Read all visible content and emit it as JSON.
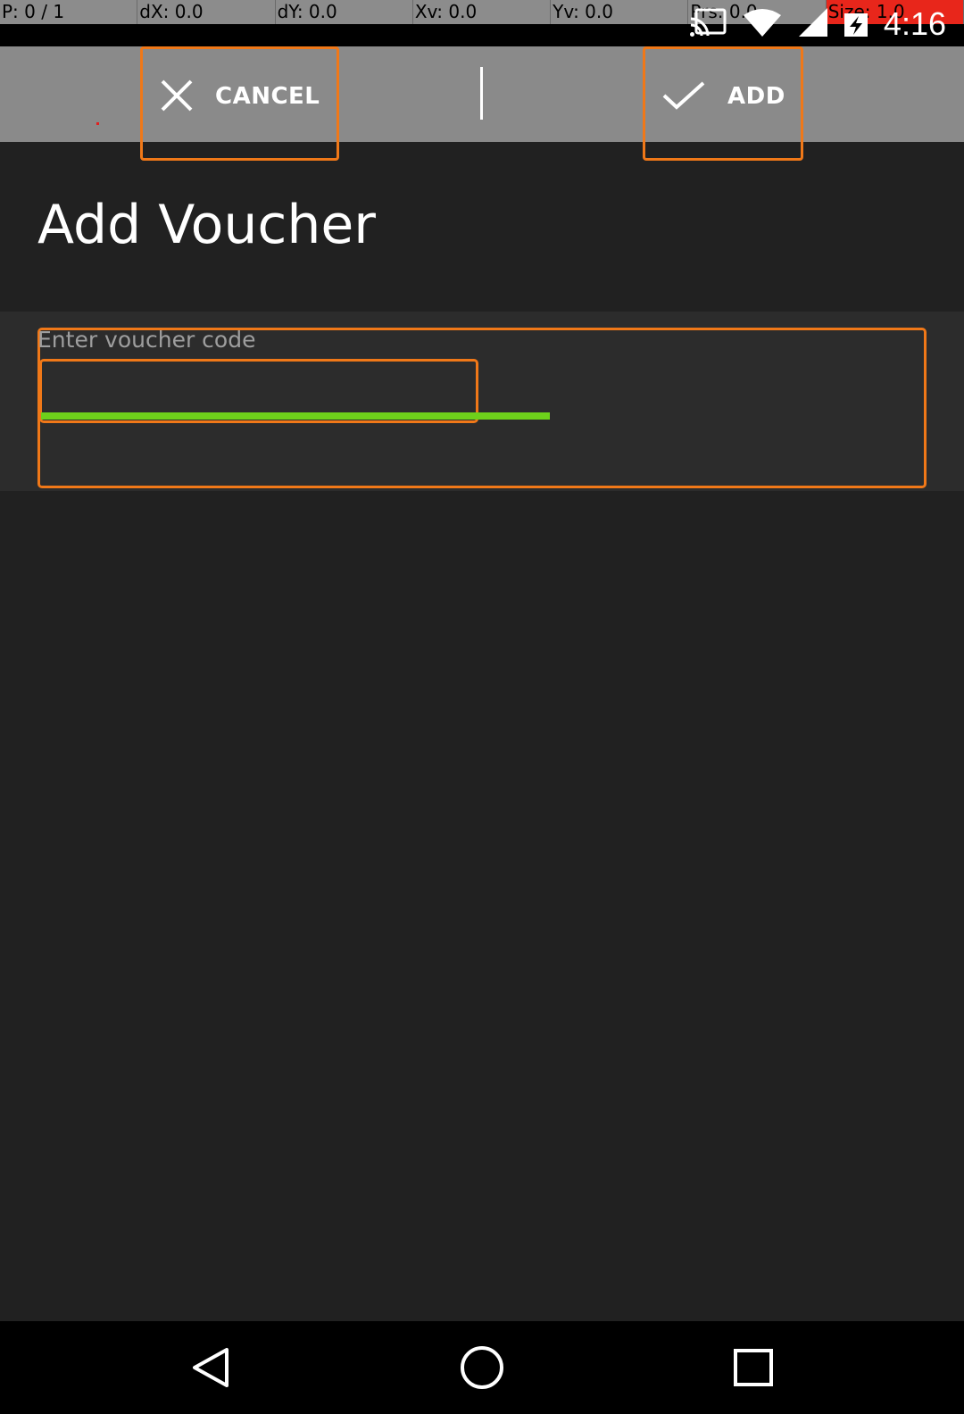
{
  "debug_overlay": {
    "pointer": "P: 0 / 1",
    "dx": "dX: 0.0",
    "dy": "dY: 0.0",
    "xv": "Xv: 0.0",
    "yv": "Yv: 0.0",
    "prs": "Prs: 0.0",
    "size": "Size: 1.0"
  },
  "status_bar": {
    "time": "4:16",
    "icons": [
      "cast-icon",
      "wifi-icon",
      "cell-signal-icon",
      "battery-charging-icon"
    ]
  },
  "toolbar": {
    "cancel_label": "CANCEL",
    "cancel_icon": "close-icon",
    "add_label": "ADD",
    "add_icon": "check-icon"
  },
  "page": {
    "title": "Add Voucher"
  },
  "voucher_form": {
    "hint": "Enter voucher code",
    "value": ""
  },
  "nav_bar": {
    "icons": [
      "back-icon",
      "home-icon",
      "recents-icon"
    ]
  },
  "colors": {
    "background": "#212121",
    "toolbar": "#8a8a8a",
    "highlight": "#f07818",
    "underline": "#6ed11b",
    "debug_size": "#e8261b"
  }
}
